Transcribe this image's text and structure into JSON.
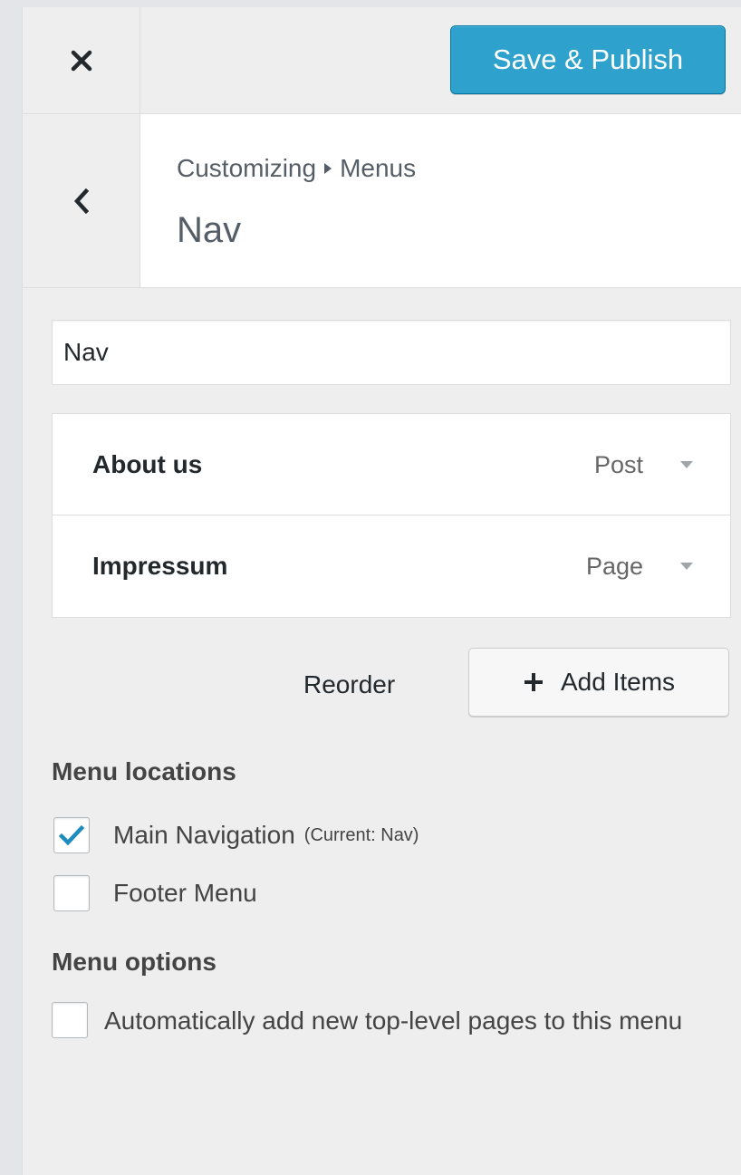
{
  "header": {
    "close_icon": "close-icon",
    "save_label": "Save & Publish"
  },
  "section": {
    "back_icon": "chevron-left-icon",
    "breadcrumb_parent": "Customizing",
    "breadcrumb_current": "Menus",
    "title": "Nav"
  },
  "menu": {
    "name_value": "Nav",
    "items": [
      {
        "title": "About us",
        "type": "Post"
      },
      {
        "title": "Impressum",
        "type": "Page"
      }
    ],
    "reorder_label": "Reorder",
    "add_items_label": "Add Items"
  },
  "locations": {
    "heading": "Menu locations",
    "options": [
      {
        "label": "Main Navigation",
        "note": "(Current: Nav)",
        "checked": true
      },
      {
        "label": "Footer Menu",
        "note": "",
        "checked": false
      }
    ]
  },
  "options": {
    "heading": "Menu options",
    "auto_add_label": "Automatically add new top-level pages to this menu",
    "auto_add_checked": false
  },
  "colors": {
    "primary": "#2ea2cc",
    "check": "#1e8cbe",
    "panel_bg": "#eeeeee"
  }
}
